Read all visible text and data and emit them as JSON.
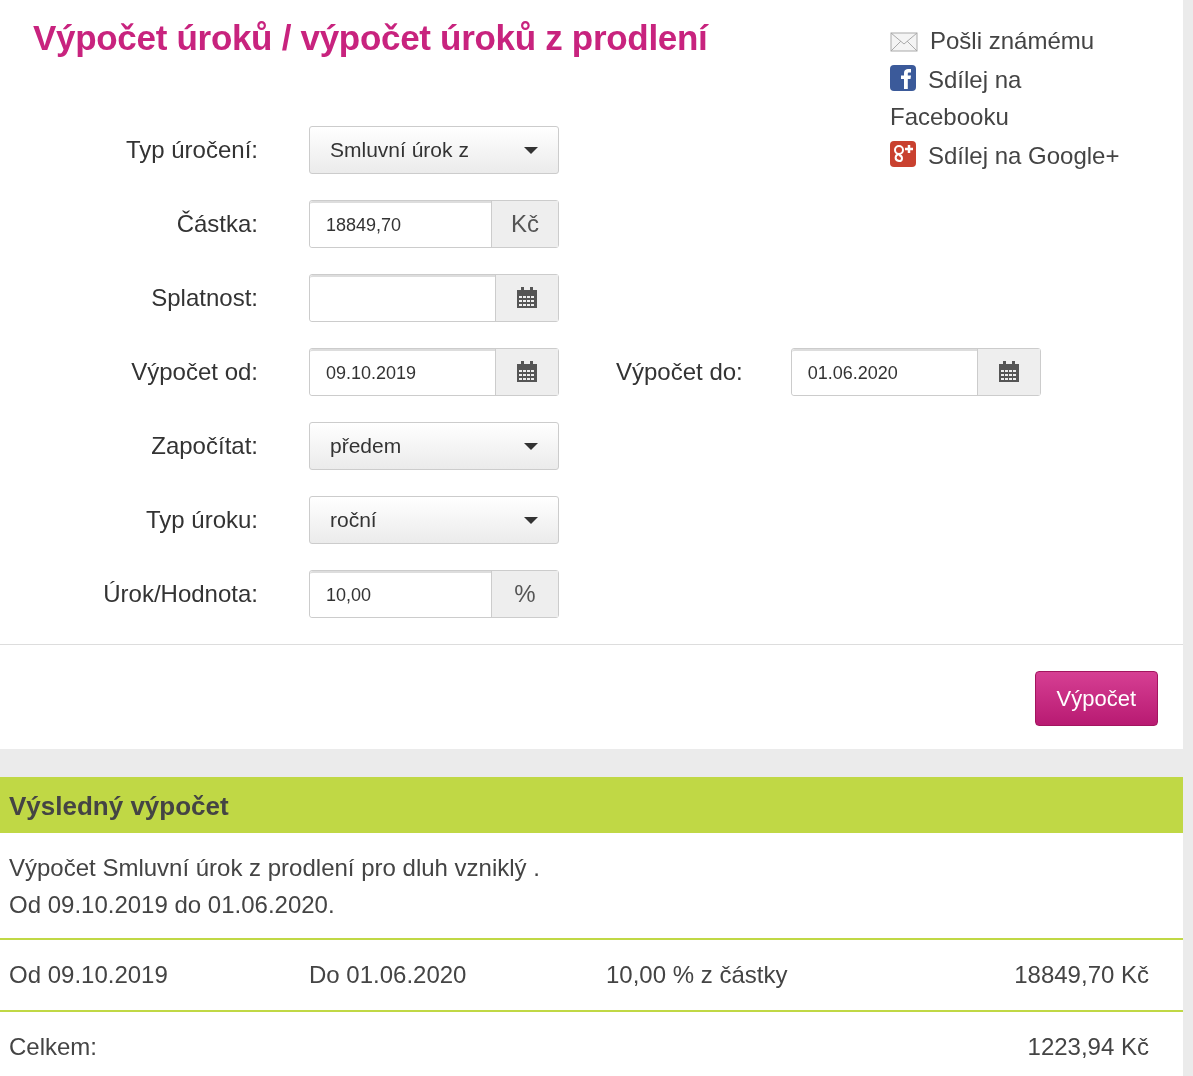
{
  "title": "Výpočet úroků / výpočet úroků z prodlení",
  "share_links": [
    {
      "kind": "email",
      "label": "Pošli známému"
    },
    {
      "kind": "facebook",
      "label": "Sdílej na Facebooku"
    },
    {
      "kind": "google",
      "label": "Sdílej na Google+"
    }
  ],
  "form_rows": [
    {
      "label": "Typ úročení:",
      "kind": "select",
      "value": "Smluvní úrok z"
    },
    {
      "label": "Částka:",
      "kind": "addon",
      "value": "18849,70",
      "addon": "Kč"
    },
    {
      "label": "Splatnost:",
      "kind": "date"
    },
    {
      "label": "Výpočet od:",
      "kind": "date",
      "value": "09.10.2019",
      "second": {
        "label": "Výpočet do:",
        "kind": "date",
        "value": "01.06.2020"
      }
    },
    {
      "label": "Započítat:",
      "kind": "select",
      "value": "předem"
    },
    {
      "label": "Typ úroku:",
      "kind": "select",
      "value": "roční"
    },
    {
      "label": "Úrok/Hodnota:",
      "kind": "addon",
      "value": "10,00",
      "addon": "%"
    }
  ],
  "submit_button": "Výpočet",
  "result": {
    "heading": "Výsledný výpočet",
    "description": [
      "Výpočet Smluvní úrok z prodlení pro dluh vzniklý .",
      "Od 09.10.2019 do 01.06.2020."
    ],
    "rows": [
      [
        "Od 09.10.2019",
        "Do 01.06.2020",
        "10,00 % z částky",
        "18849,70 Kč"
      ]
    ],
    "total": {
      "label": "Celkem:",
      "value": "1223,94 Kč"
    }
  }
}
